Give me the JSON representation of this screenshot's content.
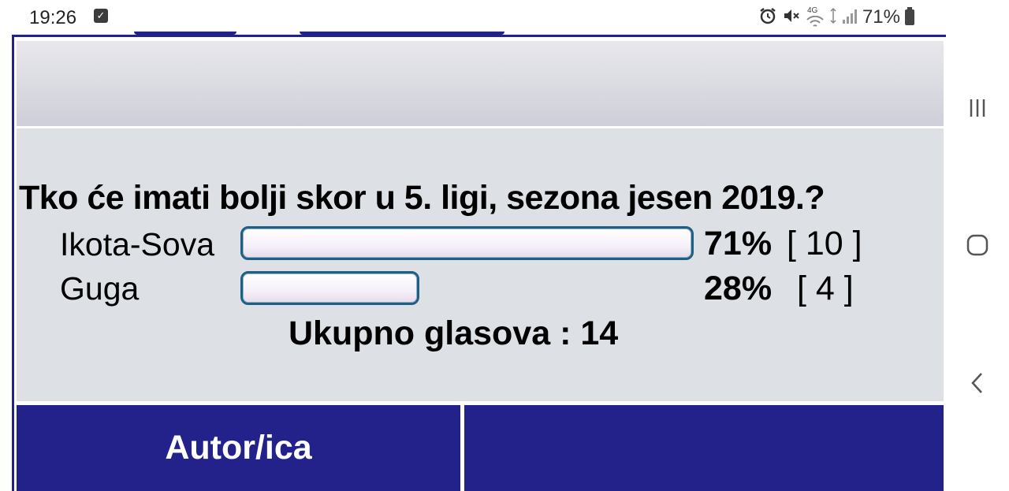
{
  "status_bar": {
    "time": "19:26",
    "battery": "71%",
    "network": "4G",
    "icons": [
      "alarm-icon",
      "mute-icon",
      "wifi-icon",
      "signal-icon",
      "battery-icon"
    ]
  },
  "poll": {
    "question": "Tko će imati bolji skor u 5. ligi, sezona jesen 2019.?",
    "options": [
      {
        "label": "Ikota-Sova",
        "percent": "71%",
        "votes": "[ 10 ]",
        "fraction": 0.71
      },
      {
        "label": "Guga",
        "percent": "28%",
        "votes": "[ 4 ]",
        "fraction": 0.28
      }
    ],
    "total": "Ukupno glasova : 14"
  },
  "footer": {
    "author_label": "Autor/ica"
  },
  "colors": {
    "accent": "#22228a",
    "poll_bg": "#dde1e6",
    "bar_border": "#1e5f86"
  },
  "navbar": {
    "icons": [
      "recent-apps-icon",
      "home-icon",
      "back-icon"
    ]
  }
}
